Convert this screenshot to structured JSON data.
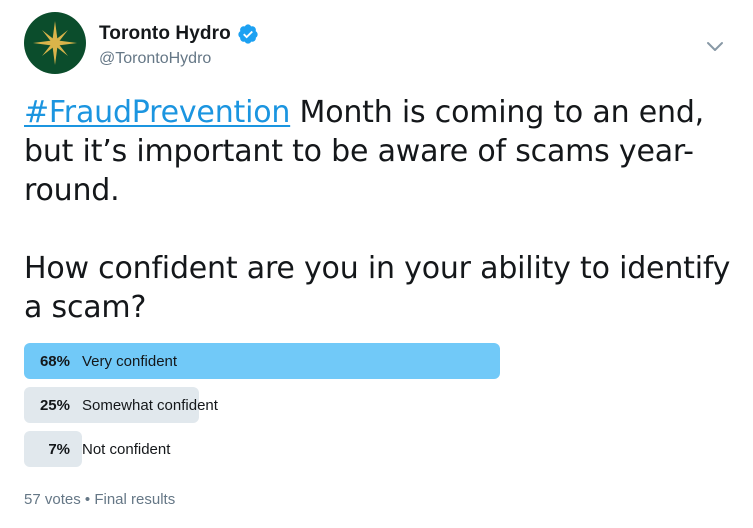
{
  "author": {
    "display_name": "Toronto Hydro",
    "handle": "@TorontoHydro",
    "verified": true,
    "avatar_icon": "toronto-hydro-logo",
    "avatar_color": "#0b4d2c",
    "logo_color": "#d9b44a"
  },
  "tweet": {
    "hashtag": "#FraudPrevention",
    "text_after_hashtag": " Month is coming to an end, but it’s important to be aware of scams year-round.",
    "question": "How confident are you in your ability to identify a scam?",
    "link_color": "#1b95e0"
  },
  "poll": {
    "choices": [
      {
        "percent_label": "68%",
        "percent": 68,
        "label": "Very confident",
        "winner": true
      },
      {
        "percent_label": "25%",
        "percent": 25,
        "label": "Somewhat confident",
        "winner": false
      },
      {
        "percent_label": "7%",
        "percent": 7,
        "label": "Not confident",
        "winner": false
      }
    ],
    "votes": "57 votes",
    "separator": "•",
    "status": "Final results",
    "winner_color": "#71c9f8",
    "bar_color": "#e1e8ed"
  }
}
